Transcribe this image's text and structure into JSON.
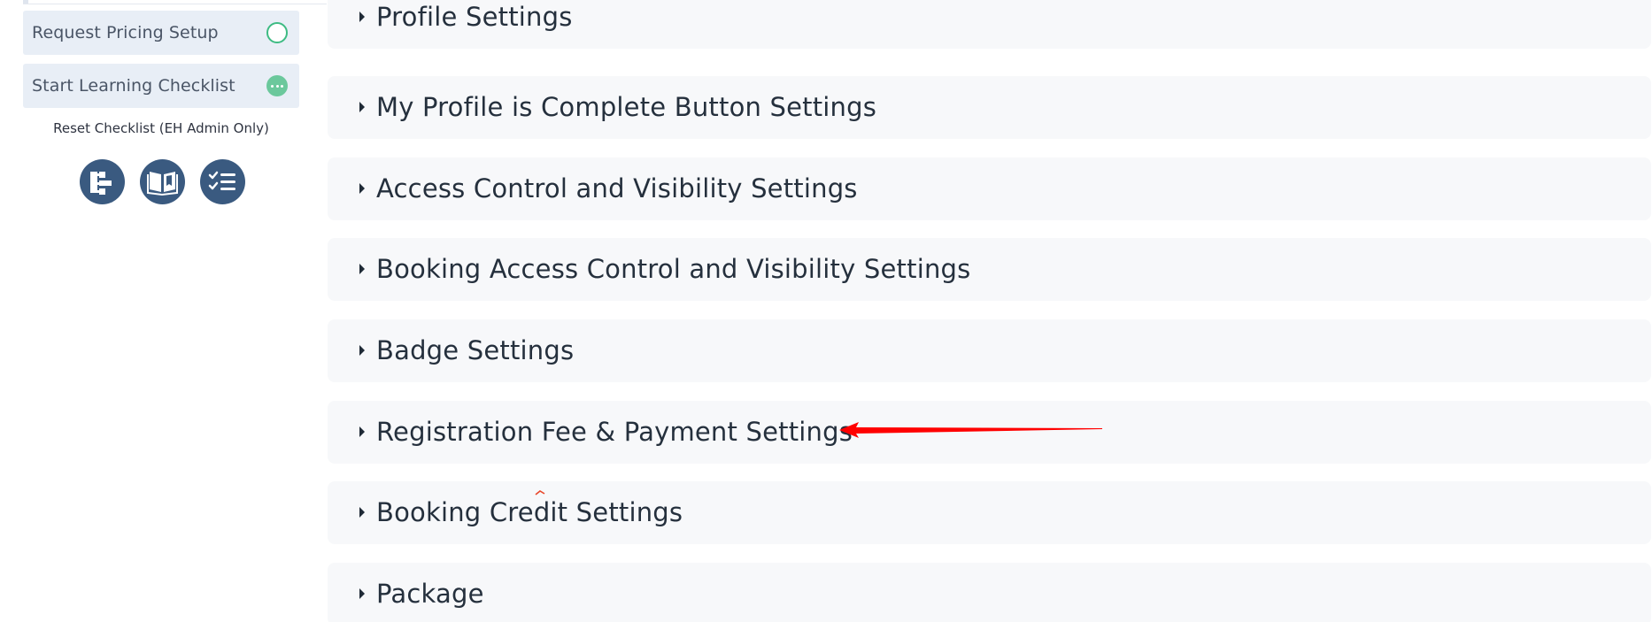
{
  "sidebar": {
    "checklist": [
      {
        "label": "Request Pricing Setup",
        "status": "not-started",
        "status_icon": "empty-circle-icon"
      },
      {
        "label": "Start Learning Checklist",
        "status": "in-progress",
        "status_icon": "ellipsis-circle-icon"
      }
    ],
    "reset_label": "Reset Checklist (EH Admin Only)",
    "quick_icons": [
      "sitemap-icon",
      "book-open-icon",
      "checklist-icon"
    ]
  },
  "settings_sections": [
    {
      "title": "Profile Settings"
    },
    {
      "title": "My Profile is Complete Button Settings"
    },
    {
      "title": "Access Control and Visibility Settings"
    },
    {
      "title": "Booking Access Control and Visibility Settings"
    },
    {
      "title": "Badge Settings"
    },
    {
      "title": "Registration Fee & Payment Settings"
    },
    {
      "title": "Booking Credit Settings"
    },
    {
      "title": "Package"
    }
  ],
  "colors": {
    "accent": "#3a5a80",
    "success": "#3dbb83",
    "panel": "#f7f8fa",
    "annotation": "#ff0000"
  }
}
